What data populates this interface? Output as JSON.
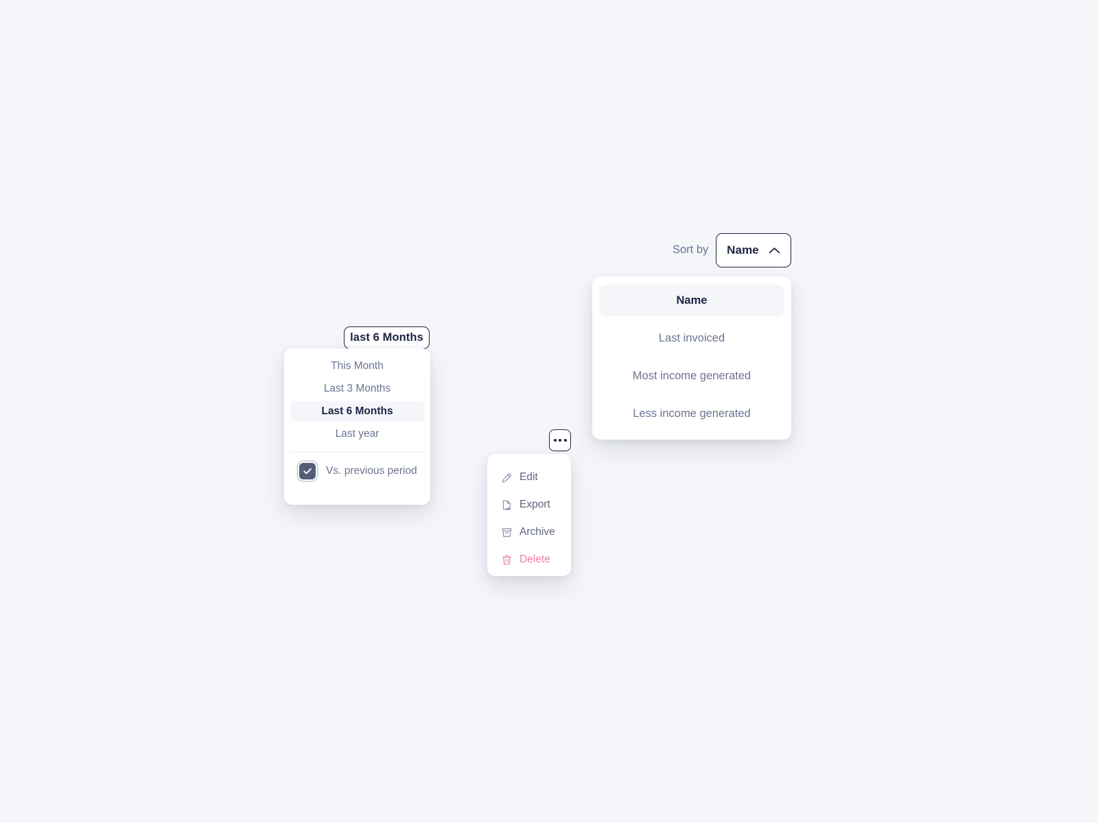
{
  "theme": {
    "page_background": "#f5f6fa",
    "panel_background": "#ffffff",
    "accent_dark": "#1c2541",
    "muted_text": "#6b7391",
    "selected_row_background": "#f4f6fa",
    "danger": "#ef7ea1",
    "checkbox_fill": "#555d76"
  },
  "date_range": {
    "button_label": "last 6 Months",
    "button_icon": "none",
    "options": [
      {
        "label": "This Month",
        "selected": false
      },
      {
        "label": "Last 3 Months",
        "selected": false
      },
      {
        "label": "Last 6 Months",
        "selected": true
      },
      {
        "label": "Last year",
        "selected": false
      }
    ],
    "compare": {
      "label": "Vs. previous period",
      "checked": true,
      "icon": "check-icon"
    }
  },
  "actions_menu": {
    "trigger_icon": "kebab-horizontal-icon",
    "items": [
      {
        "label": "Edit",
        "icon": "pencil-icon",
        "danger": false
      },
      {
        "label": "Export",
        "icon": "file-export-icon",
        "danger": false
      },
      {
        "label": "Archive",
        "icon": "archive-icon",
        "danger": false
      },
      {
        "label": "Delete",
        "icon": "trash-icon",
        "danger": true
      }
    ]
  },
  "sort": {
    "label": "Sort by",
    "button_value": "Name",
    "button_icon": "chevron-up-icon",
    "options": [
      {
        "label": "Name",
        "selected": true
      },
      {
        "label": "Last invoiced",
        "selected": false
      },
      {
        "label": "Most income generated",
        "selected": false
      },
      {
        "label": "Less income generated",
        "selected": false
      }
    ]
  }
}
